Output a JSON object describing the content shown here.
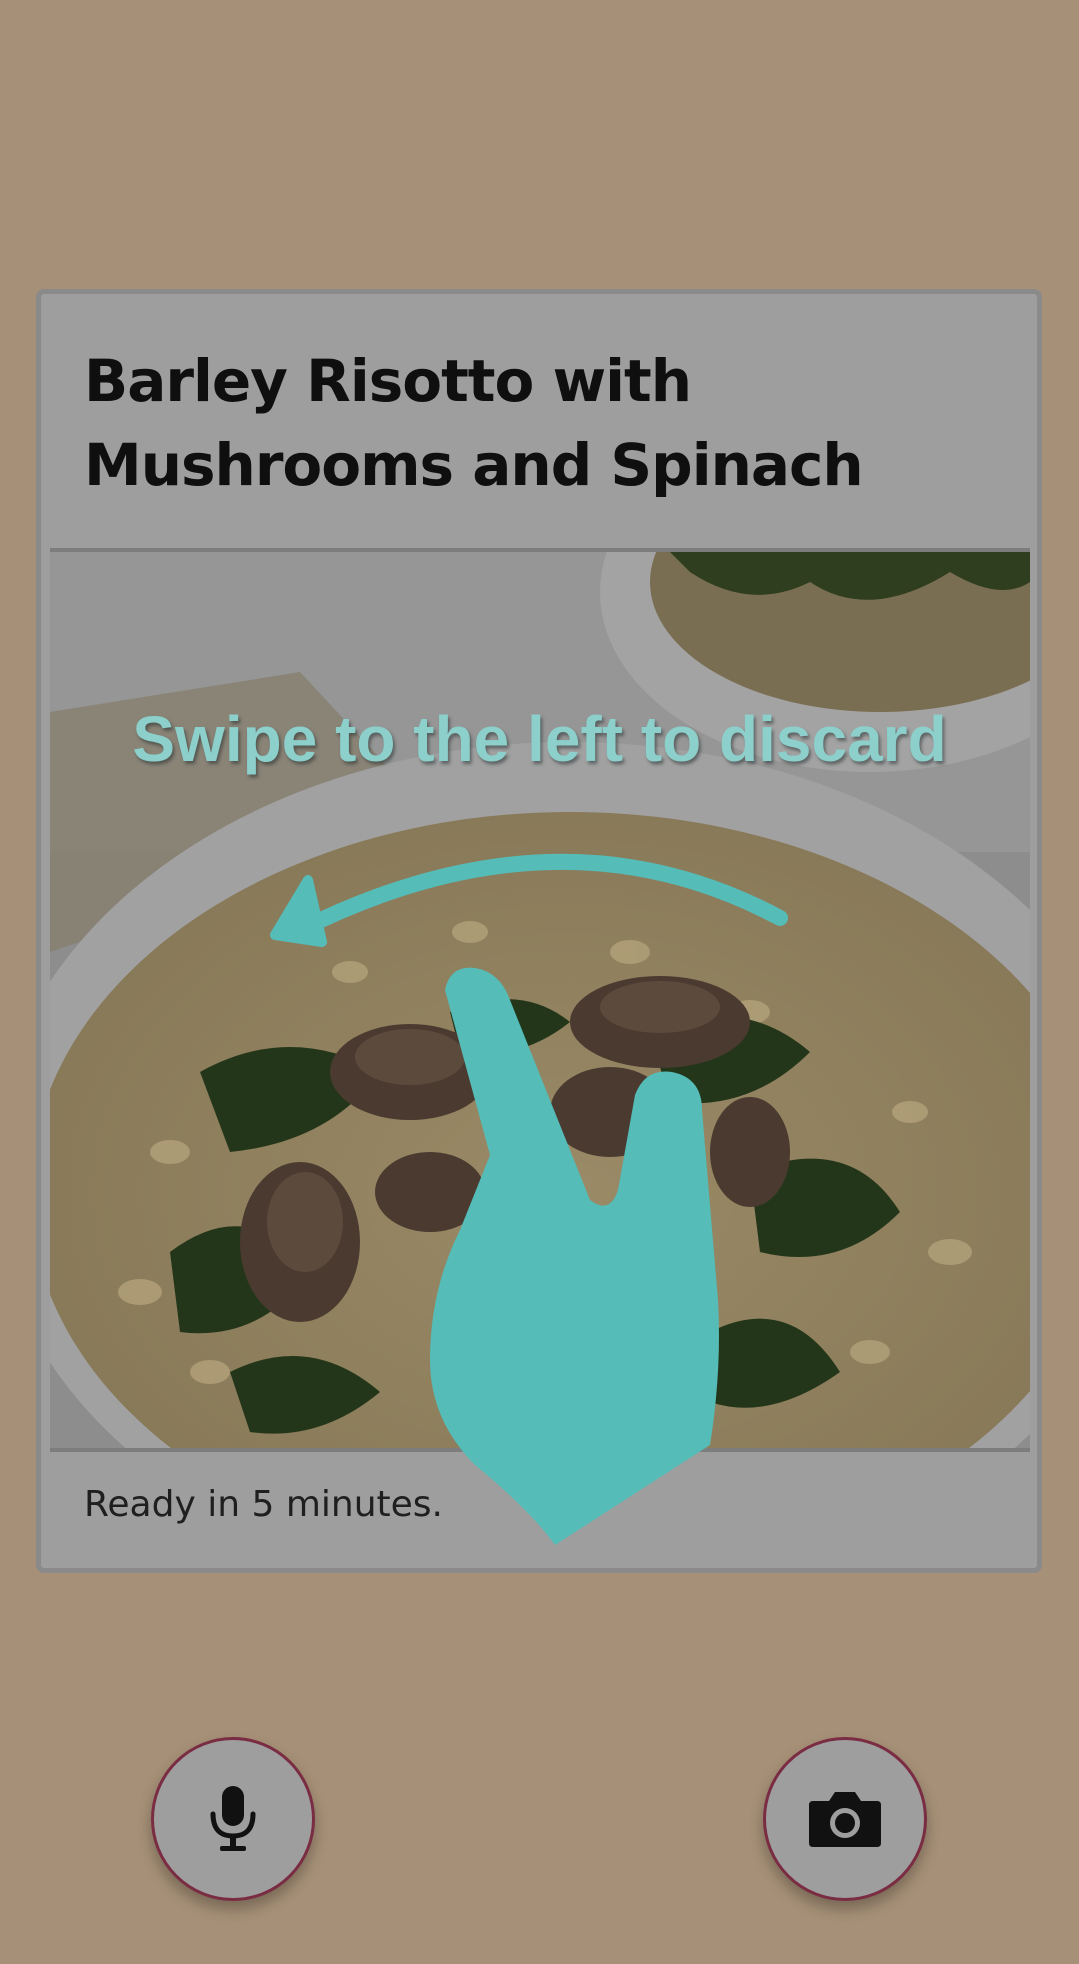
{
  "recipe": {
    "title": "Barley Risotto with Mushrooms and Spinach",
    "ready": "Ready in 5 minutes."
  },
  "overlay": {
    "hint": "Swipe to the left to discard",
    "gesture_icon": "swipe-left-hand-icon",
    "accent_color": "#55bcb8"
  },
  "actions": {
    "voice_icon": "microphone-icon",
    "camera_icon": "camera-icon"
  },
  "colors": {
    "background": "#a69077",
    "card": "#9e9e9e",
    "button_ring": "#7a2c43"
  }
}
